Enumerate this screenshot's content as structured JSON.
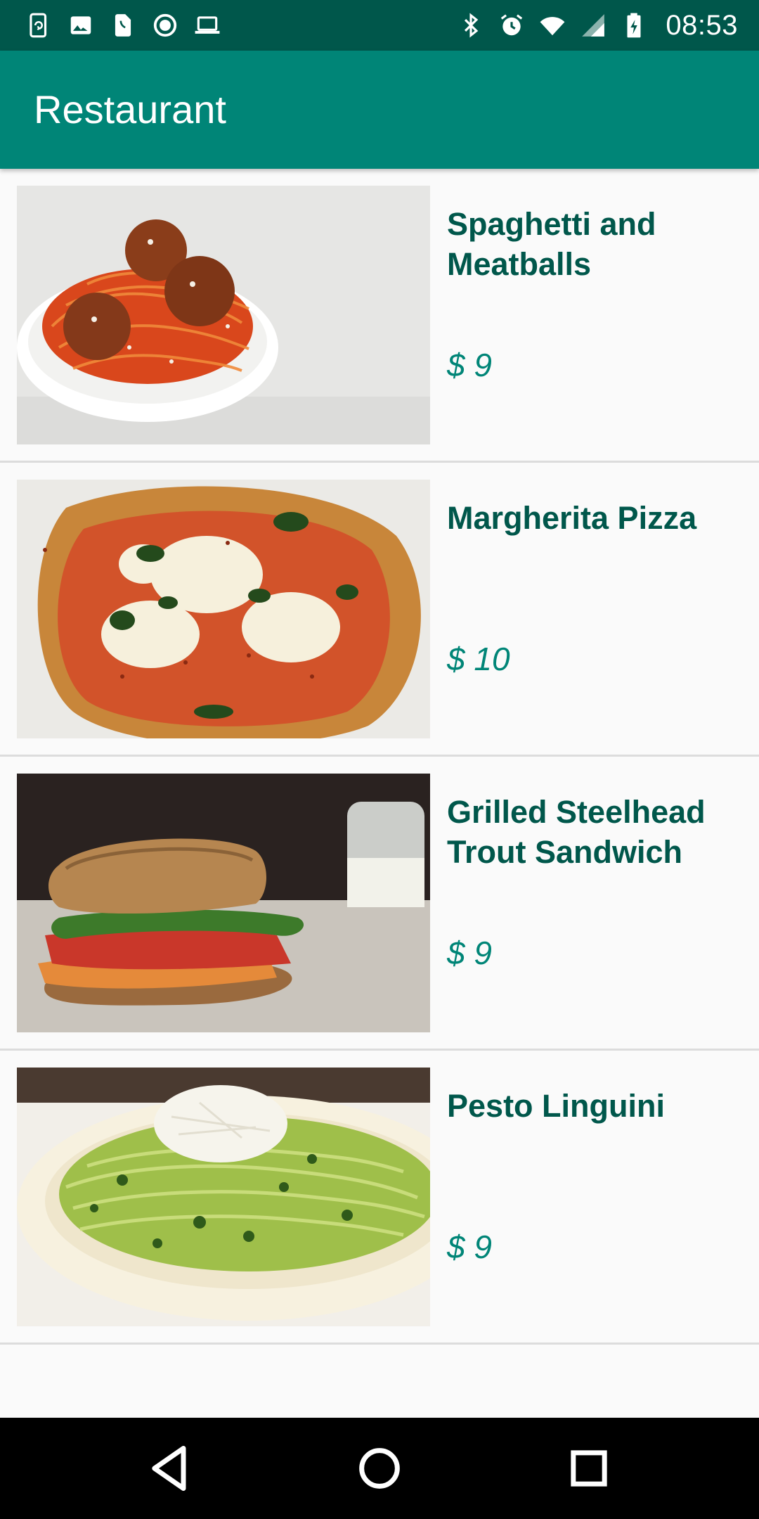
{
  "status_bar": {
    "time": "08:53",
    "left_icons": [
      "phone-sync-icon",
      "image-icon",
      "sim-icon",
      "record-icon",
      "laptop-icon"
    ],
    "right_icons": [
      "bluetooth-icon",
      "alarm-icon",
      "wifi-icon",
      "signal-icon",
      "battery-icon"
    ]
  },
  "app_bar": {
    "title": "Restaurant"
  },
  "menu": {
    "items": [
      {
        "name": "Spaghetti and Meatballs",
        "price": "$ 9",
        "image": "spaghetti-meatballs"
      },
      {
        "name": "Margherita Pizza",
        "price": "$ 10",
        "image": "margherita-pizza"
      },
      {
        "name": "Grilled Steelhead Trout Sandwich",
        "price": "$ 9",
        "image": "trout-sandwich"
      },
      {
        "name": "Pesto Linguini",
        "price": "$ 9",
        "image": "pesto-linguini"
      }
    ]
  },
  "nav_bar": {
    "buttons": [
      "back-icon",
      "home-icon",
      "recents-icon"
    ]
  },
  "colors": {
    "status_bar": "#00574b",
    "app_bar": "#008577",
    "item_title": "#00574b",
    "item_price": "#008577",
    "background": "#fafafa",
    "divider": "#dcdcdc"
  }
}
